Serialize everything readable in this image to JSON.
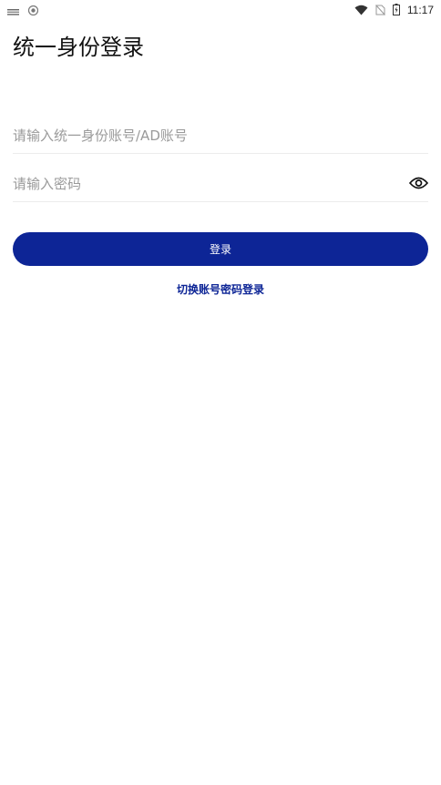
{
  "status_bar": {
    "time": "11:17",
    "left_icons": [
      "notification-icon",
      "shield-app-icon"
    ],
    "right_icons": [
      "wifi-icon",
      "no-sim-icon",
      "battery-charging-icon"
    ]
  },
  "page": {
    "title": "统一身份登录"
  },
  "form": {
    "account_placeholder": "请输入统一身份账号/AD账号",
    "password_placeholder": "请输入密码",
    "login_label": "登录",
    "switch_label": "切换账号密码登录"
  },
  "colors": {
    "accent": "#0d2596",
    "placeholder": "#9a9a9a",
    "divider": "#ececec"
  }
}
